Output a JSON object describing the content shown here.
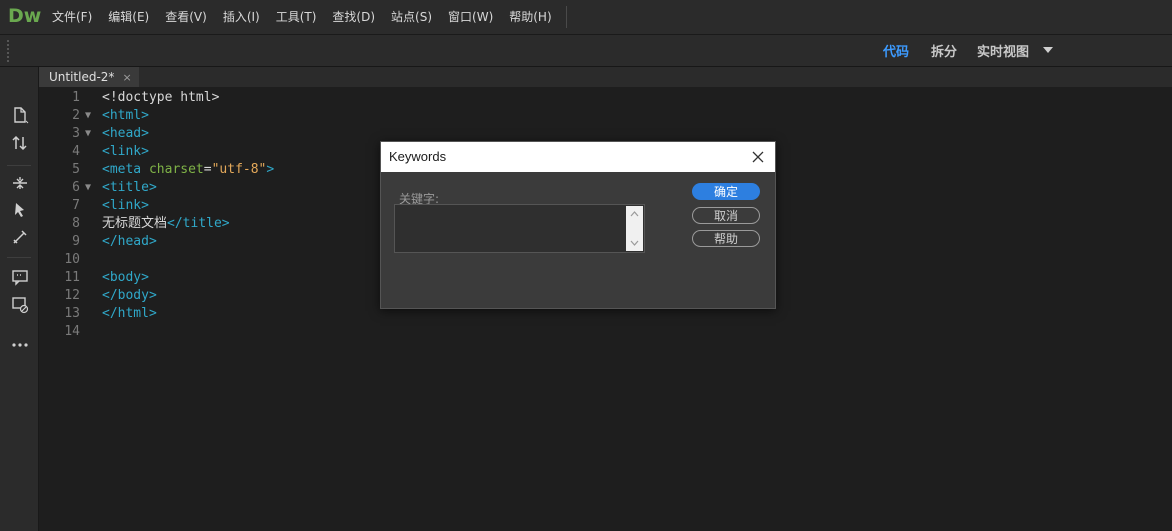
{
  "app": {
    "logo": "Dw"
  },
  "menu": [
    "文件(F)",
    "编辑(E)",
    "查看(V)",
    "插入(I)",
    "工具(T)",
    "查找(D)",
    "站点(S)",
    "窗口(W)",
    "帮助(H)"
  ],
  "views": {
    "code": "代码",
    "split": "拆分",
    "live": "实时视图"
  },
  "document_tab": {
    "title": "Untitled-2*",
    "close": "×"
  },
  "tool_icons": [
    "new-file-icon",
    "sort-icon",
    "expand-icon",
    "select-parent-icon",
    "format-icon",
    "comment-icon",
    "remove-comment-icon",
    "more-icon"
  ],
  "code": {
    "line_numbers": [
      "1",
      "2",
      "3",
      "4",
      "5",
      "6",
      "7",
      "8",
      "9",
      "10",
      "11",
      "12",
      "13",
      "14"
    ],
    "lines": [
      {
        "parts": [
          {
            "t": "txt",
            "v": "<!doctype html>"
          }
        ]
      },
      {
        "parts": [
          {
            "t": "tag",
            "v": "<html>"
          }
        ]
      },
      {
        "parts": [
          {
            "t": "tag",
            "v": "<head>"
          }
        ]
      },
      {
        "parts": [
          {
            "t": "tag",
            "v": "<link>"
          }
        ]
      },
      {
        "parts": [
          {
            "t": "tag",
            "v": "<meta "
          },
          {
            "t": "attr",
            "v": "charset"
          },
          {
            "t": "txt",
            "v": "="
          },
          {
            "t": "val",
            "v": "\"utf-8\""
          },
          {
            "t": "tag",
            "v": ">"
          }
        ]
      },
      {
        "parts": [
          {
            "t": "tag",
            "v": "<title>"
          }
        ]
      },
      {
        "parts": [
          {
            "t": "tag",
            "v": "<link>"
          }
        ]
      },
      {
        "parts": [
          {
            "t": "txt",
            "v": "无标题文档"
          },
          {
            "t": "tag",
            "v": "</title>"
          }
        ]
      },
      {
        "parts": [
          {
            "t": "tag",
            "v": "</head>"
          }
        ]
      },
      {
        "parts": []
      },
      {
        "parts": [
          {
            "t": "tag",
            "v": "<body>"
          }
        ]
      },
      {
        "parts": [
          {
            "t": "tag",
            "v": "</body>"
          }
        ]
      },
      {
        "parts": [
          {
            "t": "tag",
            "v": "</html>"
          }
        ]
      },
      {
        "parts": []
      }
    ],
    "fold_markers": {
      "2": "▼",
      "3": "▼",
      "6": "▼"
    }
  },
  "dialog": {
    "title": "Keywords",
    "label": "关键字:",
    "value": "",
    "buttons": {
      "ok": "确定",
      "cancel": "取消",
      "help": "帮助"
    }
  },
  "colors": {
    "accent": "#2d7fe0",
    "active_view": "#3d9bff",
    "logo": "#6aa84f",
    "tag": "#30a8c9",
    "attr": "#7fb347",
    "value": "#e3a85a"
  }
}
